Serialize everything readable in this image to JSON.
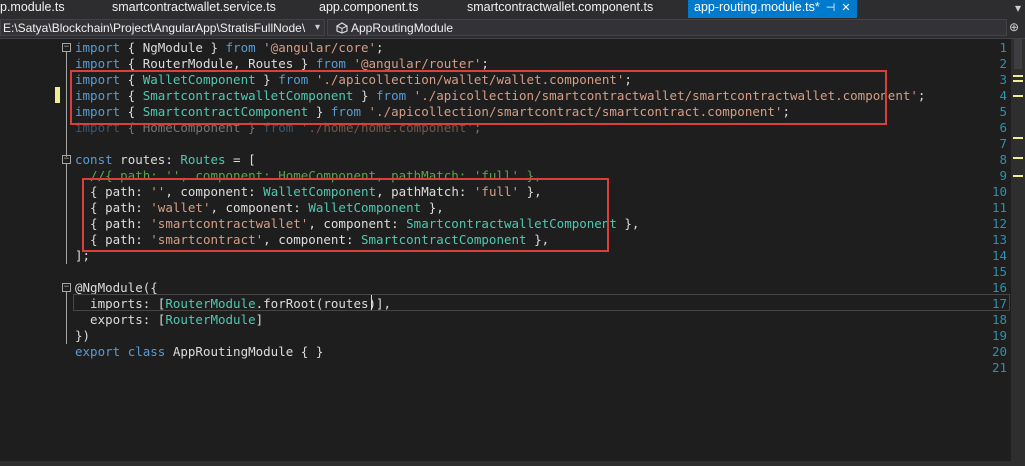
{
  "tabs": [
    {
      "label": "p.module.ts"
    },
    {
      "label": "smartcontractwallet.service.ts"
    },
    {
      "label": "app.component.ts"
    },
    {
      "label": "smartcontractwallet.component.ts"
    },
    {
      "label": "app-routing.module.ts*",
      "active": true
    }
  ],
  "tab_pin_icon": "pin-icon",
  "tab_close_icon": "close-icon",
  "nav": {
    "project_path": "E:\\Satya\\Blockchain\\Project\\AngularApp\\StratisFullNode\\",
    "member": "AppRoutingModule"
  },
  "line_numbers": [
    "1",
    "2",
    "3",
    "4",
    "5",
    "6",
    "7",
    "8",
    "9",
    "10",
    "11",
    "12",
    "13",
    "14",
    "15",
    "16",
    "17",
    "18",
    "19",
    "20",
    "21"
  ],
  "code_lines": [
    [
      [
        "kw",
        "import"
      ],
      [
        "pl",
        " { NgModule } "
      ],
      [
        "kw",
        "from"
      ],
      [
        "pl",
        " "
      ],
      [
        "str",
        "'@angular/core'"
      ],
      [
        "pl",
        ";"
      ]
    ],
    [
      [
        "kw",
        "import"
      ],
      [
        "pl",
        " { RouterModule, Routes } "
      ],
      [
        "kw",
        "from"
      ],
      [
        "pl",
        " "
      ],
      [
        "str",
        "'@angular/router'"
      ],
      [
        "pl",
        ";"
      ]
    ],
    [
      [
        "kw",
        "import"
      ],
      [
        "pl",
        " { "
      ],
      [
        "ty",
        "WalletComponent"
      ],
      [
        "pl",
        " } "
      ],
      [
        "kw",
        "from"
      ],
      [
        "pl",
        " "
      ],
      [
        "str",
        "'./apicollection/wallet/wallet.component'"
      ],
      [
        "pl",
        ";"
      ]
    ],
    [
      [
        "kw",
        "import"
      ],
      [
        "pl",
        " { "
      ],
      [
        "ty",
        "SmartcontractwalletComponent"
      ],
      [
        "pl",
        " } "
      ],
      [
        "kw",
        "from"
      ],
      [
        "pl",
        " "
      ],
      [
        "str",
        "'./apicollection/smartcontractwallet/smartcontractwallet.component'"
      ],
      [
        "pl",
        ";"
      ]
    ],
    [
      [
        "kw",
        "import"
      ],
      [
        "pl",
        " { "
      ],
      [
        "ty",
        "SmartcontractComponent"
      ],
      [
        "pl",
        " } "
      ],
      [
        "kw",
        "from"
      ],
      [
        "pl",
        " "
      ],
      [
        "str",
        "'./apicollection/smartcontract/smartcontract.component'"
      ],
      [
        "pl",
        ";"
      ]
    ],
    [
      [
        "kw",
        "import"
      ],
      [
        "pl",
        " { HomeComponent } "
      ],
      [
        "kw",
        "from"
      ],
      [
        "pl",
        " "
      ],
      [
        "str",
        "'./home/home.component'"
      ],
      [
        "pl",
        ";"
      ]
    ],
    [],
    [
      [
        "kw",
        "const"
      ],
      [
        "pl",
        " routes: "
      ],
      [
        "ty",
        "Routes"
      ],
      [
        "pl",
        " = ["
      ]
    ],
    [
      [
        "cm",
        "  //{ path: '', component: HomeComponent, pathMatch: 'full' },"
      ]
    ],
    [
      [
        "pl",
        "  { path: "
      ],
      [
        "str",
        "''"
      ],
      [
        "pl",
        ", component: "
      ],
      [
        "ty",
        "WalletComponent"
      ],
      [
        "pl",
        ", pathMatch: "
      ],
      [
        "str",
        "'full'"
      ],
      [
        "pl",
        " },"
      ]
    ],
    [
      [
        "pl",
        "  { path: "
      ],
      [
        "str",
        "'wallet'"
      ],
      [
        "pl",
        ", component: "
      ],
      [
        "ty",
        "WalletComponent"
      ],
      [
        "pl",
        " },"
      ]
    ],
    [
      [
        "pl",
        "  { path: "
      ],
      [
        "str",
        "'smartcontractwallet'"
      ],
      [
        "pl",
        ", component: "
      ],
      [
        "ty",
        "SmartcontractwalletComponent"
      ],
      [
        "pl",
        " },"
      ]
    ],
    [
      [
        "pl",
        "  { path: "
      ],
      [
        "str",
        "'smartcontract'"
      ],
      [
        "pl",
        ", component: "
      ],
      [
        "ty",
        "SmartcontractComponent"
      ],
      [
        "pl",
        " },"
      ]
    ],
    [
      [
        "pl",
        "];"
      ]
    ],
    [],
    [
      [
        "pl",
        "@NgModule({"
      ]
    ],
    [
      [
        "pl",
        "  imports: ["
      ],
      [
        "ty",
        "RouterModule"
      ],
      [
        "pl",
        ".forRoot(routes)],"
      ]
    ],
    [
      [
        "pl",
        "  exports: ["
      ],
      [
        "ty",
        "RouterModule"
      ],
      [
        "pl",
        "]"
      ]
    ],
    [
      [
        "pl",
        "})"
      ]
    ],
    [
      [
        "kw",
        "export"
      ],
      [
        "pl",
        " "
      ],
      [
        "kw",
        "class"
      ],
      [
        "pl",
        " AppRoutingModule { }"
      ]
    ],
    []
  ],
  "colors": {
    "keyword": "#569cd6",
    "string": "#d69d85",
    "type": "#4ec9b0",
    "comment": "#57a64a",
    "line_number": "#2b91af",
    "highlight_box": "#d9403a",
    "active_tab": "#007acc"
  }
}
